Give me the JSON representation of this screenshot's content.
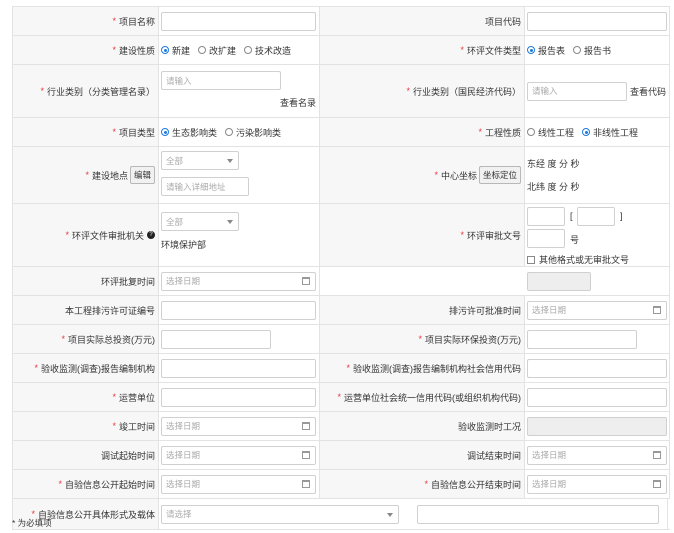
{
  "required_mark": "*",
  "project_name": {
    "label": "项目名称",
    "value": ""
  },
  "project_code": {
    "label": "项目代码",
    "value": ""
  },
  "construction_nature": {
    "label": "建设性质",
    "options": [
      "新建",
      "改扩建",
      "技术改造"
    ],
    "selected": "新建"
  },
  "eia_doc_type": {
    "label": "环评文件类型",
    "options": [
      "报告表",
      "报告书"
    ],
    "selected": "报告表"
  },
  "industry_category_mgmt": {
    "label": "行业类别（分类管理名录）",
    "placeholder": "请输入",
    "link": "查看名录"
  },
  "industry_category_econ": {
    "label": "行业类别（国民经济代码）",
    "placeholder": "请输入",
    "link": "查看代码"
  },
  "project_type": {
    "label": "项目类型",
    "options": [
      "生态影响类",
      "污染影响类"
    ],
    "selected": "生态影响类"
  },
  "engineering_nature": {
    "label": "工程性质",
    "options": [
      "线性工程",
      "非线性工程"
    ],
    "selected": "非线性工程"
  },
  "construction_site": {
    "label": "建设地点",
    "edit_button": "编辑",
    "select_value": "全部",
    "address_placeholder": "请输入详细地址"
  },
  "center_coord": {
    "label": "中心坐标",
    "locate_button": "坐标定位",
    "east": "东经 度 分 秒",
    "north": "北纬 度 分 秒"
  },
  "eia_approval_authority": {
    "label": "环评文件审批机关",
    "select_value": "全部",
    "value": "环境保护部"
  },
  "eia_approval_number": {
    "label": "环评审批文号",
    "bracket_open": "[",
    "bracket_close": "]",
    "suffix": "号",
    "checkbox_label": "其他格式或无审批文号"
  },
  "eia_approval_time": {
    "label": "环评批复时间",
    "placeholder": "选择日期"
  },
  "discharge_permit_no": {
    "label": "本工程排污许可证编号",
    "value": ""
  },
  "discharge_permit_time": {
    "label": "排污许可批准时间",
    "placeholder": "选择日期"
  },
  "total_investment": {
    "label": "项目实际总投资(万元)",
    "value": ""
  },
  "env_investment": {
    "label": "项目实际环保投资(万元)",
    "value": ""
  },
  "monitor_org": {
    "label": "验收监测(调查)报告编制机构",
    "value": ""
  },
  "monitor_org_code": {
    "label": "验收监测(调查)报告编制机构社会信用代码",
    "value": ""
  },
  "operator": {
    "label": "运营单位",
    "value": ""
  },
  "operator_code": {
    "label": "运营单位社会统一信用代码(或组织机构代码)",
    "value": ""
  },
  "completion_time": {
    "label": "竣工时间",
    "placeholder": "选择日期"
  },
  "monitor_condition": {
    "label": "验收监测时工况",
    "value": ""
  },
  "debug_start": {
    "label": "调试起始时间",
    "placeholder": "选择日期"
  },
  "debug_end": {
    "label": "调试结束时间",
    "placeholder": "选择日期"
  },
  "disclosure_start": {
    "label": "自验信息公开起始时间",
    "placeholder": "选择日期"
  },
  "disclosure_end": {
    "label": "自验信息公开结束时间",
    "placeholder": "选择日期"
  },
  "disclosure_form": {
    "label": "自验信息公开具体形式及载体",
    "placeholder": "请选择",
    "value": ""
  },
  "footnote": "* 为必填项"
}
